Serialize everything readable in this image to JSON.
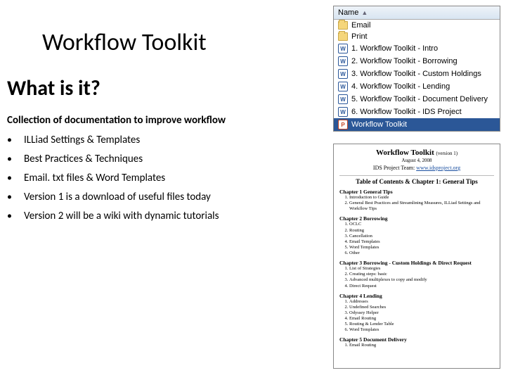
{
  "title": "Workflow Toolkit",
  "heading": "What is it?",
  "subtitle": "Collection of documentation to improve workflow",
  "bullets": [
    "ILLiad Settings & Templates",
    "Best Practices & Techniques",
    "Email. txt files & Word Templates",
    "Version 1 is a download of useful files today",
    "Version 2 will be a wiki with dynamic tutorials"
  ],
  "filepane": {
    "header": "Name",
    "rows": [
      {
        "icon": "folder",
        "label": "Email",
        "selected": false
      },
      {
        "icon": "folder",
        "label": "Print",
        "selected": false
      },
      {
        "icon": "word",
        "label": "1. Workflow Toolkit - Intro",
        "selected": false
      },
      {
        "icon": "word",
        "label": "2. Workflow Toolkit - Borrowing",
        "selected": false
      },
      {
        "icon": "word",
        "label": "3. Workflow Toolkit - Custom Holdings",
        "selected": false
      },
      {
        "icon": "word",
        "label": "4. Workflow Toolkit - Lending",
        "selected": false
      },
      {
        "icon": "word",
        "label": "5. Workflow Toolkit - Document Delivery",
        "selected": false
      },
      {
        "icon": "word",
        "label": "6. Workflow Toolkit - IDS Project",
        "selected": false
      },
      {
        "icon": "ppt",
        "label": "Workflow Toolkit",
        "selected": true
      }
    ]
  },
  "doc": {
    "title": "Workflow Toolkit",
    "version": "(version 1)",
    "date": "August 4, 2008",
    "team_prefix": "IDS Project Team: ",
    "team_link": "www.idsproject.org",
    "toc_heading": "Table of Contents & Chapter 1: General Tips",
    "chapters": [
      {
        "title": "Chapter 1   General Tips",
        "items": [
          "Introduction to Guide",
          "General Best Practices and Streamlining Measures, ILLiad Settings and Workflow Tips"
        ]
      },
      {
        "title": "Chapter 2   Borrowing",
        "items": [
          "OCLC",
          "Routing",
          "Cancellation",
          "Email Templates",
          "Word Templates",
          "Other"
        ]
      },
      {
        "title": "Chapter 3   Borrowing - Custom Holdings & Direct Request",
        "items": [
          "List of Strategies",
          "Creating steps: basic",
          "Advanced multiplexes to copy and modify",
          "Direct Request"
        ]
      },
      {
        "title": "Chapter 4   Lending",
        "items": [
          "Addresses",
          "Undefined Searches",
          "Odyssey Helper",
          "Email Routing",
          "Routing & Lender Table",
          "Word Templates"
        ]
      },
      {
        "title": "Chapter 5   Document Delivery",
        "items": [
          "Email Routing"
        ]
      }
    ]
  }
}
